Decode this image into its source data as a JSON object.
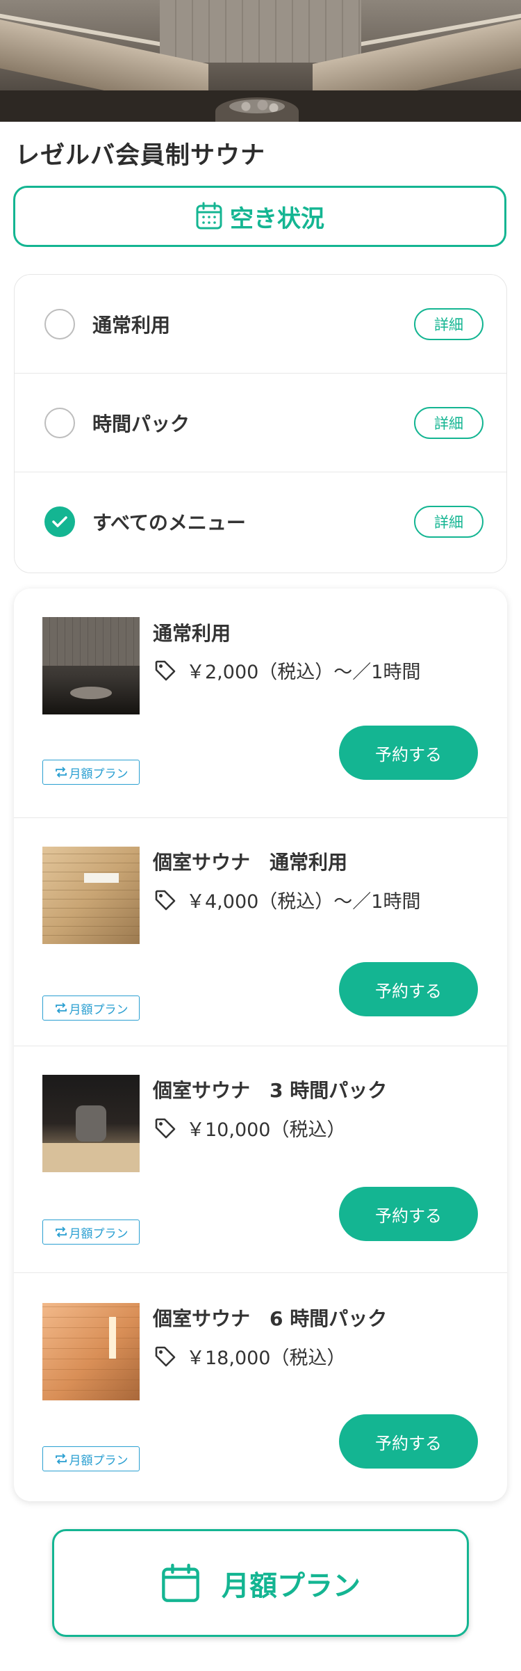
{
  "facility": {
    "name": "レゼルバ会員制サウナ"
  },
  "availability_button": {
    "label": "空き状況",
    "icon": "calendar-icon"
  },
  "menu_filter": {
    "options": [
      {
        "label": "通常利用",
        "selected": false,
        "detail_label": "詳細"
      },
      {
        "label": "時間パック",
        "selected": false,
        "detail_label": "詳細"
      },
      {
        "label": "すべてのメニュー",
        "selected": true,
        "detail_label": "詳細"
      }
    ]
  },
  "plans": [
    {
      "name": "通常利用",
      "price": "￥2,000（税込）〜／1時間",
      "reserve_label": "予約する",
      "badge": "月額プラン"
    },
    {
      "name": "個室サウナ　通常利用",
      "price": "￥4,000（税込）〜／1時間",
      "reserve_label": "予約する",
      "badge": "月額プラン"
    },
    {
      "name": "個室サウナ　3 時間パック",
      "price": "￥10,000（税込）",
      "reserve_label": "予約する",
      "badge": "月額プラン"
    },
    {
      "name": "個室サウナ　6 時間パック",
      "price": "￥18,000（税込）",
      "reserve_label": "予約する",
      "badge": "月額プラン"
    }
  ],
  "monthly_plan_button": {
    "label": "月額プラン",
    "icon": "calendar-icon"
  },
  "colors": {
    "accent": "#14b592",
    "badge": "#2a9fd1",
    "text": "#333333"
  }
}
